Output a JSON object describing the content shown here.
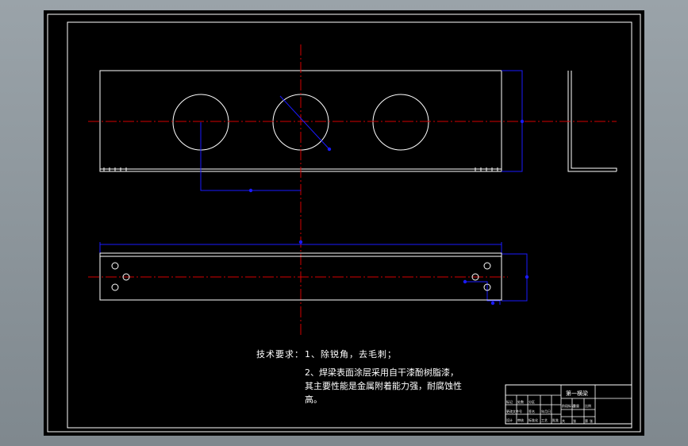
{
  "drawing": {
    "notes_heading": "技术要求：",
    "note1": "1、除锐角，去毛刺；",
    "note2_line1": "2、焊梁表面涂层采用自干漆酚树脂漆，",
    "note2_line2": "其主要性能是金属附着能力强，耐腐蚀性",
    "note2_line3": "高。"
  },
  "title_block": {
    "part_name": "第一横梁",
    "cells": [
      "标记",
      "处数",
      "分区",
      "更改文件号",
      "签名",
      "年月日",
      "设计",
      "标准化",
      "阶段标记",
      "重量",
      "比例",
      "审核",
      "工艺",
      "批准",
      "共",
      "张",
      "第",
      "张"
    ]
  },
  "colors": {
    "background": "#000000",
    "geometry": "#ffffff",
    "center_line": "#d40000",
    "dimension": "#1a1aff",
    "frame_outer": "#8f989e"
  }
}
